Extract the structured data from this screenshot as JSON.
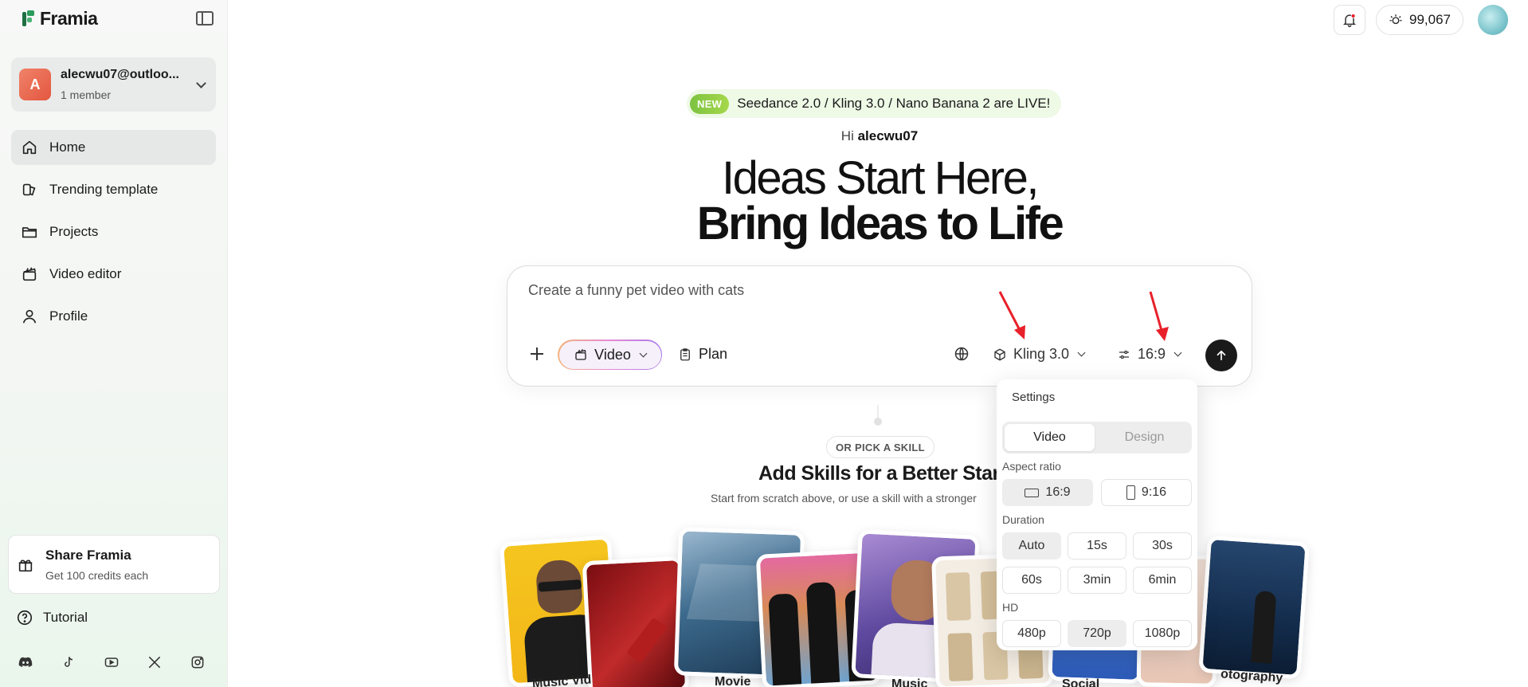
{
  "app": {
    "name": "Framia"
  },
  "account": {
    "initial": "A",
    "email": "alecwu07@outloo...",
    "members": "1 member"
  },
  "nav": {
    "items": [
      {
        "label": "Home",
        "icon": "home-icon",
        "active": true
      },
      {
        "label": "Trending template",
        "icon": "template-icon",
        "active": false
      },
      {
        "label": "Projects",
        "icon": "folder-icon",
        "active": false
      },
      {
        "label": "Video editor",
        "icon": "clapperboard-icon",
        "active": false
      },
      {
        "label": "Profile",
        "icon": "user-icon",
        "active": false
      }
    ]
  },
  "share": {
    "title": "Share Framia",
    "subtitle": "Get 100 credits each"
  },
  "tutorial": {
    "label": "Tutorial"
  },
  "socials": [
    "discord-icon",
    "tiktok-icon",
    "youtube-icon",
    "x-icon",
    "instagram-icon"
  ],
  "topbar": {
    "credits": "99,067"
  },
  "announcement": {
    "badge": "NEW",
    "text": "Seedance 2.0 / Kling 3.0 / Nano Banana 2 are LIVE!"
  },
  "greeting": {
    "prefix": "Hi",
    "username": "alecwu07"
  },
  "headline": {
    "line1": "Ideas Start Here,",
    "line2": "Bring Ideas to Life"
  },
  "prompt": {
    "placeholder": "Create a funny pet video with cats",
    "mode": "Video",
    "plan": "Plan",
    "model": "Kling 3.0",
    "ratio": "16:9"
  },
  "skills": {
    "pill": "OR PICK A SKILL",
    "title": "Add Skills for a Better Start",
    "subtitle": "Start from scratch above, or use a skill with a stronger",
    "cards": [
      "Music Vid",
      "Movie",
      "Music",
      "Social",
      "otography"
    ]
  },
  "settings": {
    "title": "Settings",
    "tabs": [
      "Video",
      "Design"
    ],
    "aspect_label": "Aspect ratio",
    "aspect": [
      "16:9",
      "9:16"
    ],
    "duration_label": "Duration",
    "durations": [
      "Auto",
      "15s",
      "30s",
      "60s",
      "3min",
      "6min"
    ],
    "hd_label": "HD",
    "hd": [
      "480p",
      "720p",
      "1080p"
    ]
  },
  "colors": {
    "accent_green": "#7cc241",
    "arrow_red": "#e8202a",
    "send_bg": "#1a1a1a"
  }
}
